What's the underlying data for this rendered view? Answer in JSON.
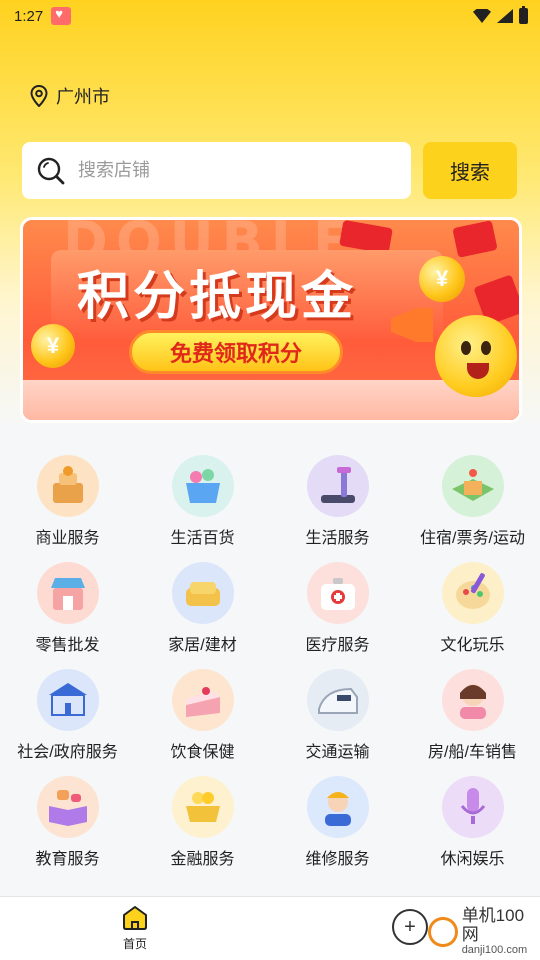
{
  "status_bar": {
    "time": "1:27"
  },
  "location": {
    "city": "广州市"
  },
  "search": {
    "placeholder": "搜索店铺",
    "button_label": "搜索"
  },
  "banner": {
    "title": "积分抵现金",
    "subtitle": "免费领取积分",
    "background_text": "DOUBLE ELEVEN",
    "coin_symbol": "¥"
  },
  "categories": [
    {
      "label": "商业服务",
      "icon": "business-service-icon",
      "color": "#fde3c4"
    },
    {
      "label": "生活百货",
      "icon": "shopping-basket-icon",
      "color": "#d9f2ee"
    },
    {
      "label": "生活服务",
      "icon": "treadmill-icon",
      "color": "#e4dcf7"
    },
    {
      "label": "住宿/票务/运动",
      "icon": "hotel-icon",
      "color": "#d5f1d8"
    },
    {
      "label": "零售批发",
      "icon": "storefront-icon",
      "color": "#fddbd3"
    },
    {
      "label": "家居/建材",
      "icon": "sofa-icon",
      "color": "#dce6fb"
    },
    {
      "label": "医疗服务",
      "icon": "medical-kit-icon",
      "color": "#fde0db"
    },
    {
      "label": "文化玩乐",
      "icon": "paint-palette-icon",
      "color": "#fdf0c8"
    },
    {
      "label": "社会/政府服务",
      "icon": "government-building-icon",
      "color": "#dbe6fb"
    },
    {
      "label": "饮食保健",
      "icon": "cake-icon",
      "color": "#fde5cf"
    },
    {
      "label": "交通运输",
      "icon": "train-icon",
      "color": "#e6ecf3"
    },
    {
      "label": "房/船/车销售",
      "icon": "salesperson-icon",
      "color": "#fde0de"
    },
    {
      "label": "教育服务",
      "icon": "open-book-icon",
      "color": "#fde3d2"
    },
    {
      "label": "金融服务",
      "icon": "coin-cart-icon",
      "color": "#fdf1cf"
    },
    {
      "label": "维修服务",
      "icon": "repair-worker-icon",
      "color": "#dce8fb"
    },
    {
      "label": "休闲娱乐",
      "icon": "microphone-icon",
      "color": "#ecdcf7"
    }
  ],
  "bottom_nav": {
    "home_label": "首页"
  },
  "watermark": {
    "name": "单机100网",
    "url": "danji100.com"
  },
  "colors": {
    "accent": "#fdd21c",
    "banner_red": "#ff5b3a"
  }
}
